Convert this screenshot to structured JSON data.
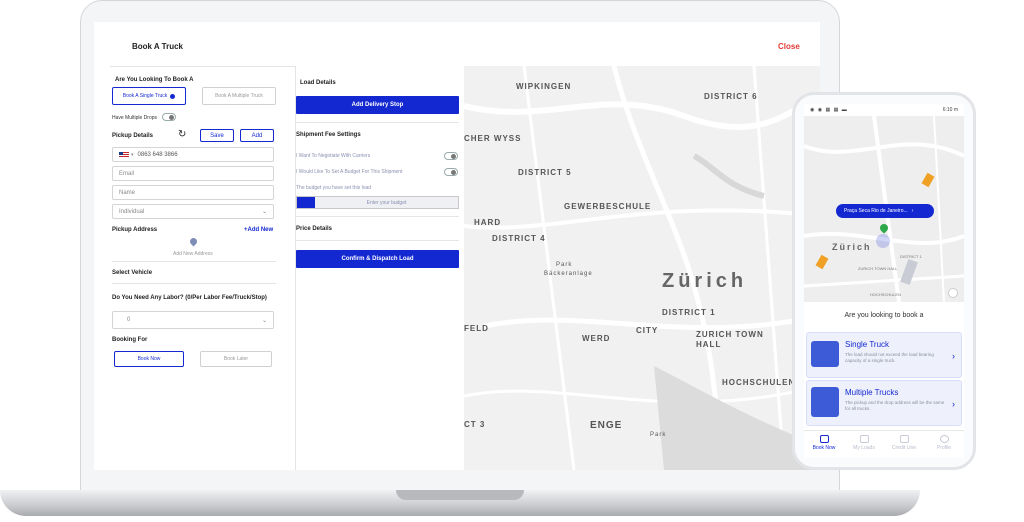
{
  "app": {
    "title": "Book A Truck",
    "close_label": "Close"
  },
  "form": {
    "question": "Are You Looking To Book A",
    "single_truck": "Book A Single Truck",
    "info_icon": "info-icon",
    "multiple_truck": "Book A Multiple Truck",
    "multiple_drops": "Have Multiple Drops",
    "pickup_details": "Pickup Details",
    "save_label": "Save",
    "add_label": "Add",
    "phone_value": "0863 648 3866",
    "email_placeholder": "Email",
    "name_placeholder": "Name",
    "type_value": "Individual",
    "pickup_address": "Pickup Address",
    "add_new": "+Add New",
    "add_new_address": "Add New Address",
    "select_vehicle": "Select Vehicle",
    "labor_question": "Do You Need Any Labor? (0/Per Labor Fee/Truck/Stop)",
    "labor_value": "0",
    "booking_for": "Booking For",
    "book_now": "Book Now",
    "book_later": "Book Later"
  },
  "middle": {
    "load_details": "Load Details",
    "add_delivery_stop": "Add Delivery Stop",
    "shipment_fee": "Shipment Fee Settings",
    "negotiate": "I Want To Negotiate With Carriers",
    "set_budget": "I Would Like To Set A Budget For This Shipment",
    "budget_note": "The budget you have set this load",
    "budget_placeholder": "Enter your budget",
    "price_details": "Price Details",
    "confirm": "Confirm & Dispatch Load"
  },
  "map": {
    "labels": {
      "wipkingen": "WIPKINGEN",
      "district6": "DISTRICT 6",
      "wyss": "CHER WYSS",
      "district5": "DISTRICT 5",
      "gewerbe": "GEWERBESCHULE",
      "hard": "HARD",
      "district4": "DISTRICT 4",
      "park": "Park",
      "park_name": "Bäckeranlage",
      "zurich": "Zürich",
      "district1": "DISTRICT 1",
      "feld": "FELD",
      "city": "CITY",
      "werd": "WERD",
      "town_hall": "ZURICH TOWN HALL",
      "hochschulen": "HOCHSCHULEN",
      "enge": "ENGE",
      "district3": "CT 3",
      "park2": "Park"
    }
  },
  "phone": {
    "time": "6:10 m",
    "location_pill": "Praça Seca Rio de Janeiro...",
    "map_zurich": "Zürich",
    "map_town_hall": "ZURICH TOWN HALL",
    "map_hochschulen": "HOCHSCHULEN",
    "map_district": "DISTRICT 1",
    "prompt": "Are you looking to book a",
    "single_title": "Single Truck",
    "single_desc": "The load should not exceed the load bearing capacity of a single truck.",
    "multi_title": "Multiple Trucks",
    "multi_desc": "The pickup and the drop address will be the same for all trucks.",
    "nav": [
      "Book Now",
      "My Loads",
      "Credit Line",
      "Profile"
    ]
  },
  "colors": {
    "primary": "#1428d2",
    "close": "#e53935"
  }
}
